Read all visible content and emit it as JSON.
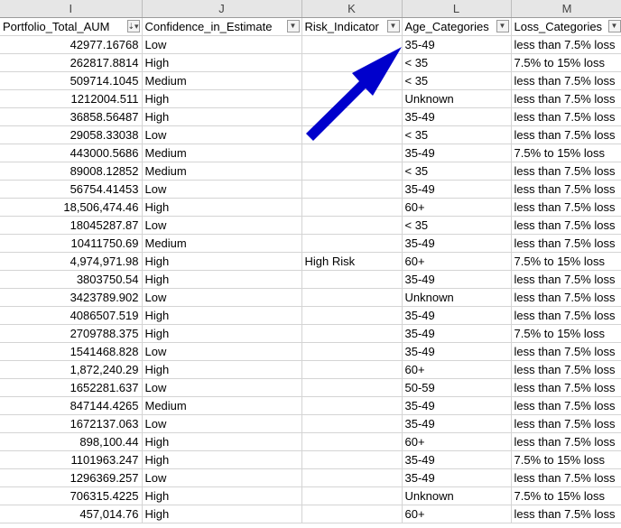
{
  "column_letters": [
    "I",
    "J",
    "K",
    "L",
    "M"
  ],
  "headers": [
    {
      "label": "Portfolio_Total_AUM",
      "sorted": true
    },
    {
      "label": "Confidence_in_Estimate",
      "sorted": false
    },
    {
      "label": "Risk_Indicator",
      "sorted": false
    },
    {
      "label": "Age_Categories",
      "sorted": false
    },
    {
      "label": "Loss_Categories",
      "sorted": false
    }
  ],
  "filter_glyphs": {
    "sorted": "⇣▾",
    "plain": "▼"
  },
  "arrow_color": "#0000cc",
  "rows": [
    [
      "42977.16768",
      "Low",
      "",
      "35-49",
      "less than 7.5% loss"
    ],
    [
      "262817.8814",
      "High",
      "",
      "< 35",
      "7.5% to 15% loss"
    ],
    [
      "509714.1045",
      "Medium",
      "",
      "< 35",
      "less than 7.5% loss"
    ],
    [
      "1212004.511",
      "High",
      "",
      "Unknown",
      "less than 7.5% loss"
    ],
    [
      "36858.56487",
      "High",
      "",
      "35-49",
      "less than 7.5% loss"
    ],
    [
      "29058.33038",
      "Low",
      "",
      "< 35",
      "less than 7.5% loss"
    ],
    [
      "443000.5686",
      "Medium",
      "",
      "35-49",
      "7.5% to 15% loss"
    ],
    [
      "89008.12852",
      "Medium",
      "",
      "< 35",
      "less than 7.5% loss"
    ],
    [
      "56754.41453",
      "Low",
      "",
      "35-49",
      "less than 7.5% loss"
    ],
    [
      "18,506,474.46",
      "High",
      "",
      "60+",
      "less than 7.5% loss"
    ],
    [
      "18045287.87",
      "Low",
      "",
      "< 35",
      "less than 7.5% loss"
    ],
    [
      "10411750.69",
      "Medium",
      "",
      "35-49",
      "less than 7.5% loss"
    ],
    [
      "4,974,971.98",
      "High",
      "High Risk",
      "60+",
      "7.5% to 15% loss"
    ],
    [
      "3803750.54",
      "High",
      "",
      "35-49",
      "less than 7.5% loss"
    ],
    [
      "3423789.902",
      "Low",
      "",
      "Unknown",
      "less than 7.5% loss"
    ],
    [
      "4086507.519",
      "High",
      "",
      "35-49",
      "less than 7.5% loss"
    ],
    [
      "2709788.375",
      "High",
      "",
      "35-49",
      "7.5% to 15% loss"
    ],
    [
      "1541468.828",
      "Low",
      "",
      "35-49",
      "less than 7.5% loss"
    ],
    [
      "1,872,240.29",
      "High",
      "",
      "60+",
      "less than 7.5% loss"
    ],
    [
      "1652281.637",
      "Low",
      "",
      "50-59",
      "less than 7.5% loss"
    ],
    [
      "847144.4265",
      "Medium",
      "",
      "35-49",
      "less than 7.5% loss"
    ],
    [
      "1672137.063",
      "Low",
      "",
      "35-49",
      "less than 7.5% loss"
    ],
    [
      "898,100.44",
      "High",
      "",
      "60+",
      "less than 7.5% loss"
    ],
    [
      "1101963.247",
      "High",
      "",
      "35-49",
      "7.5% to 15% loss"
    ],
    [
      "1296369.257",
      "Low",
      "",
      "35-49",
      "less than 7.5% loss"
    ],
    [
      "706315.4225",
      "High",
      "",
      "Unknown",
      "7.5% to 15% loss"
    ],
    [
      "457,014.76",
      "High",
      "",
      "60+",
      "less than 7.5% loss"
    ]
  ]
}
